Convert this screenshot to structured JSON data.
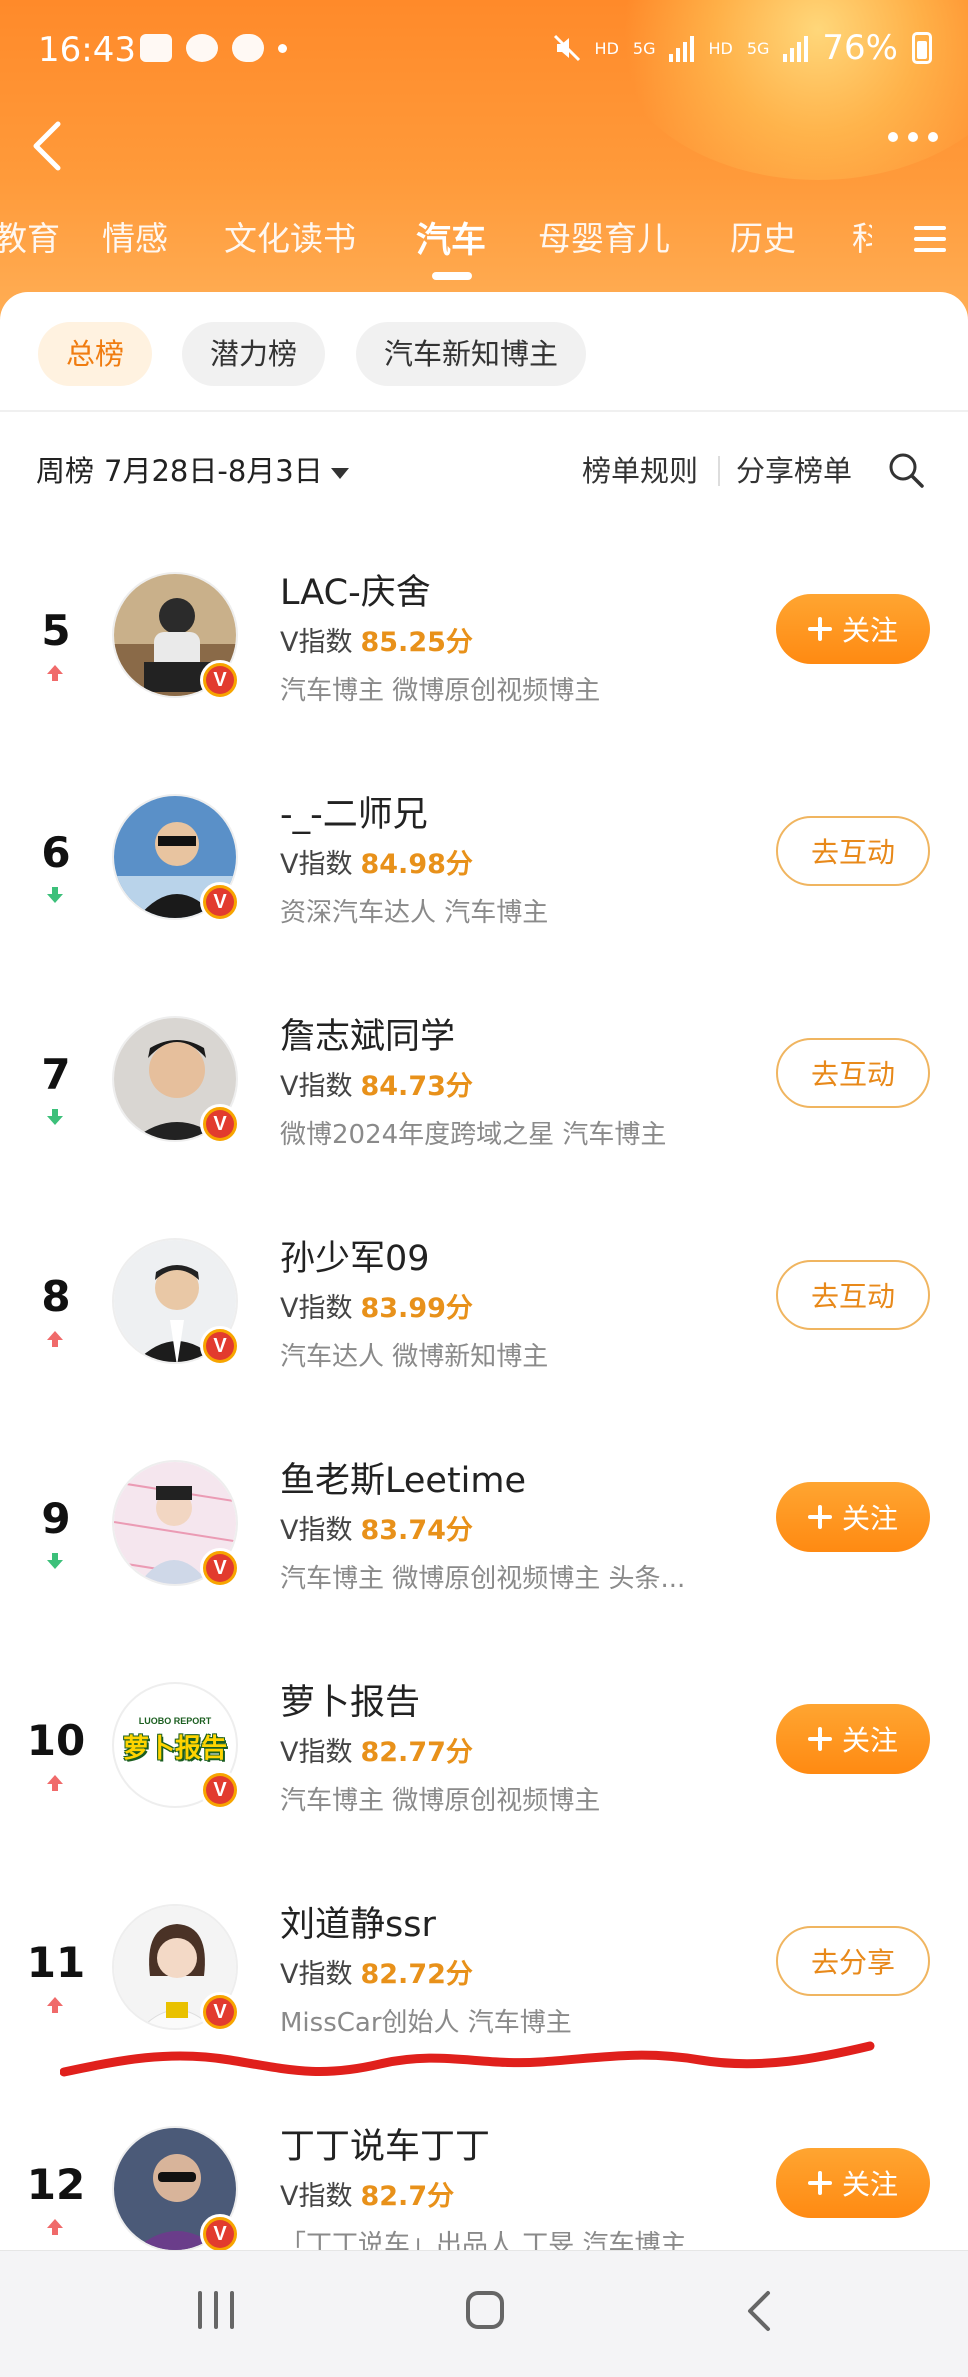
{
  "status_bar": {
    "time": "16:43",
    "battery": "76%",
    "labels": [
      "HD",
      "5G",
      "HD",
      "5G"
    ]
  },
  "header": {
    "tabs": [
      {
        "label": "教育"
      },
      {
        "label": "情感"
      },
      {
        "label": "文化读书"
      },
      {
        "label": "汽车",
        "active": true
      },
      {
        "label": "母婴育儿"
      },
      {
        "label": "历史"
      },
      {
        "label": "科"
      }
    ]
  },
  "sub_tabs": [
    {
      "label": "总榜",
      "active": true
    },
    {
      "label": "潜力榜"
    },
    {
      "label": "汽车新知博主"
    }
  ],
  "filter": {
    "period": "周榜",
    "date_range": "7月28日-8月3日",
    "rules": "榜单规则",
    "share": "分享榜单"
  },
  "score_label": "V指数",
  "rows": [
    {
      "rank": "5",
      "trend": "up",
      "name": "LAC-庆舍",
      "score": "85.25分",
      "tags": "汽车博主 微博原创视频博主",
      "button": "关注",
      "button_type": "follow"
    },
    {
      "rank": "6",
      "trend": "down",
      "name": "-_-二师兄",
      "score": "84.98分",
      "tags": "资深汽车达人 汽车博主",
      "button": "去互动",
      "button_type": "outline"
    },
    {
      "rank": "7",
      "trend": "down",
      "name": "詹志斌同学",
      "score": "84.73分",
      "tags": "微博2024年度跨域之星 汽车博主",
      "button": "去互动",
      "button_type": "outline"
    },
    {
      "rank": "8",
      "trend": "up",
      "name": "孙少军09",
      "score": "83.99分",
      "tags": "汽车达人 微博新知博主",
      "button": "去互动",
      "button_type": "outline"
    },
    {
      "rank": "9",
      "trend": "down",
      "name": "鱼老斯Leetime",
      "score": "83.74分",
      "tags": "汽车博主 微博原创视频博主 头条...",
      "button": "关注",
      "button_type": "follow"
    },
    {
      "rank": "10",
      "trend": "up",
      "name": "萝卜报告",
      "score": "82.77分",
      "tags": "汽车博主 微博原创视频博主",
      "button": "关注",
      "button_type": "follow",
      "avatar_text": "萝卜报告",
      "avatar_subtext": "LUOBO REPORT"
    },
    {
      "rank": "11",
      "trend": "up",
      "name": "刘道静ssr",
      "score": "82.72分",
      "tags": "MissCar创始人 汽车博主",
      "button": "去分享",
      "button_type": "outline"
    },
    {
      "rank": "12",
      "trend": "up",
      "name": "丁丁说车丁丁",
      "score": "82.7分",
      "tags": "「丁丁说车」出品人 丁旻 汽车博主",
      "button": "关注",
      "button_type": "follow"
    }
  ],
  "colors": {
    "header_orange": "#ff8a2a",
    "accent": "#e8911a",
    "trend_up": "#f06a6a",
    "trend_down": "#3cc07a",
    "annotation_red": "#e0201c"
  },
  "icons": [
    "back-icon",
    "more-icon",
    "menu-icon",
    "search-icon",
    "caret-down-icon",
    "verified-badge-icon",
    "trend-up-icon",
    "trend-down-icon",
    "plus-icon"
  ]
}
